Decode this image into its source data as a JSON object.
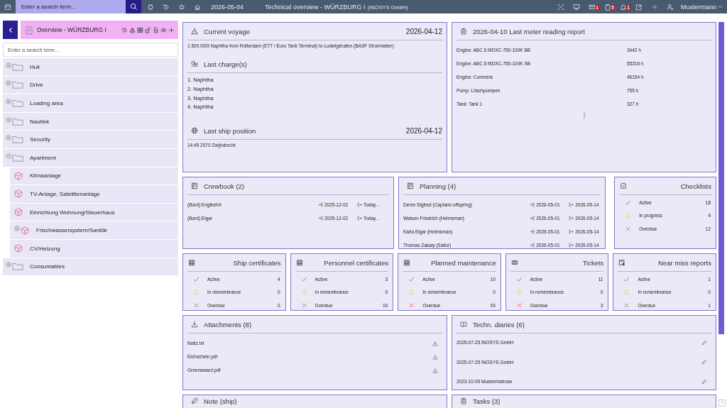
{
  "topbar": {
    "search": {
      "placeholder": "Enter a search term..."
    },
    "date": "2026-05-04",
    "title": "Technical overview - WÜRZBURG I",
    "subtitle": "(INOSYS GmbH)",
    "badges": [
      {
        "kind": "mail",
        "count": "1"
      },
      {
        "kind": "clipboard",
        "count": "5"
      },
      {
        "kind": "bell",
        "count": "1"
      }
    ],
    "user": "Mustermann"
  },
  "sidebar": {
    "title": "Overview - WÜRZBURG I",
    "search": {
      "placeholder": "Enter a search term..."
    },
    "tree": [
      {
        "label": "Hull",
        "kind": "folder",
        "expanded": false
      },
      {
        "label": "Drive",
        "kind": "folder",
        "expanded": false
      },
      {
        "label": "Loading area",
        "kind": "folder",
        "expanded": false
      },
      {
        "label": "Nautiek",
        "kind": "folder",
        "expanded": false
      },
      {
        "label": "Security",
        "kind": "folder",
        "expanded": false
      },
      {
        "label": "Apartment",
        "kind": "folder",
        "expanded": true,
        "children": [
          {
            "label": "Klimaanlage",
            "kind": "component"
          },
          {
            "label": "TV-Anlage, Satellitenanlage",
            "kind": "component"
          },
          {
            "label": "Einrichtung Wohnung/Steuerhaus",
            "kind": "component"
          },
          {
            "label": "Frischwassersystem/Sanitär",
            "kind": "component",
            "expanded": false
          },
          {
            "label": "CV/Heizung",
            "kind": "component"
          }
        ]
      },
      {
        "label": "Consumables",
        "kind": "folder",
        "expanded": false
      }
    ]
  },
  "voyage": {
    "title": "Current voyage",
    "date": "2026-04-12",
    "text": "1.500.000t Naphtha from Rotterdam (ETT / Euro Tank Terminal) to Ludwigshafen (BASF Stromhafen)",
    "charges_title": "Last charge(s)",
    "charges": [
      "1. Naphtha",
      "2. Naphtha",
      "3. Naphtha",
      "4. Naphtha"
    ],
    "position_title": "Last ship position",
    "position_date": "2026-04-12",
    "position": "14:45 2070 Zwijndrecht"
  },
  "meter": {
    "title": "2026-04-10 Last meter reading report",
    "rows": [
      {
        "name": "Engine: ABC 6 MDXC-750-100K BB",
        "value": "3442 h"
      },
      {
        "name": "Engine: ABC 6 MDXC-750-100K SB",
        "value": "55216 h"
      },
      {
        "name": "Engine: Cummins",
        "value": "46154 h"
      },
      {
        "name": "Pump: Löschpumpen",
        "value": "755 h"
      },
      {
        "name": "Tank: Tank 1",
        "value": "327 h"
      }
    ]
  },
  "crewbook": {
    "title": "Crewbook (2)",
    "rows": [
      {
        "name": "(Bord) Englbehrt",
        "in": "2025-12-02",
        "out": "Today..."
      },
      {
        "name": "(Bord) Elgar",
        "in": "2025-12-02",
        "out": "Today..."
      }
    ]
  },
  "planning": {
    "title": "Planning (4)",
    "rows": [
      {
        "name": "Derex Sigfred (Captain/-offspring)",
        "in": "2026-05-01",
        "out": "2026-05-14"
      },
      {
        "name": "Watson Friedrich (Helmsman)",
        "in": "2026-05-01",
        "out": "2026-05-14"
      },
      {
        "name": "Karla Elgar (Helmsman)",
        "in": "2026-05-01",
        "out": "2026-05-14"
      },
      {
        "name": "Thomas Zakaly (Sailor)",
        "in": "2026-05-01",
        "out": "2026-05-14"
      }
    ]
  },
  "checklists": {
    "title": "Checklists",
    "items": [
      {
        "kind": "ok",
        "label": "Active",
        "count": "18"
      },
      {
        "kind": "warn",
        "label": "In progress",
        "count": "4"
      },
      {
        "kind": "bad",
        "label": "Overdue",
        "count": "12"
      }
    ]
  },
  "summaries": [
    {
      "title": "Ship certificates",
      "kind": "calendar",
      "items": [
        {
          "kind": "ok",
          "label": "Active",
          "count": "4"
        },
        {
          "kind": "warn",
          "label": "In remembrance",
          "count": "0"
        },
        {
          "kind": "bad",
          "label": "Overdue",
          "count": "0"
        }
      ]
    },
    {
      "title": "Personnel certificates",
      "kind": "calendar",
      "items": [
        {
          "kind": "ok",
          "label": "Active",
          "count": "3"
        },
        {
          "kind": "warn",
          "label": "In remembrance",
          "count": "0"
        },
        {
          "kind": "bad",
          "label": "Overdue",
          "count": "10"
        }
      ]
    },
    {
      "title": "Planned maintenance",
      "kind": "calendar",
      "items": [
        {
          "kind": "ok",
          "label": "Active",
          "count": "10"
        },
        {
          "kind": "warn",
          "label": "In remembrance",
          "count": "0"
        },
        {
          "kind": "bad",
          "label": "Overdue",
          "count": "93"
        }
      ]
    },
    {
      "title": "Tickets",
      "kind": "ticket",
      "items": [
        {
          "kind": "ok",
          "label": "Active",
          "count": "11"
        },
        {
          "kind": "warn",
          "label": "In remembrance",
          "count": "0"
        },
        {
          "kind": "bad",
          "label": "Overdue",
          "count": "3"
        }
      ]
    },
    {
      "title": "Near miss reports",
      "kind": "report",
      "items": [
        {
          "kind": "ok",
          "label": "Active",
          "count": "1"
        },
        {
          "kind": "warn",
          "label": "In remembrance",
          "count": "0"
        },
        {
          "kind": "bad",
          "label": "Overdue",
          "count": "1"
        }
      ]
    }
  ],
  "attachments": {
    "title": "Attachments (8)",
    "files": [
      "Notiz.txt",
      "Eichschein.pdf",
      "Greenaward.pdf"
    ]
  },
  "diaries": {
    "title": "Techn. diaries (6)",
    "entries": [
      "2025-07-25 INOSYS GmbH",
      "2025-07-25 INOSYS GmbH",
      "2023-10-09 Mustermatrose"
    ]
  },
  "note": {
    "title": "Note (ship)"
  },
  "tasks": {
    "title": "Tasks (3)"
  },
  "help": "?"
}
